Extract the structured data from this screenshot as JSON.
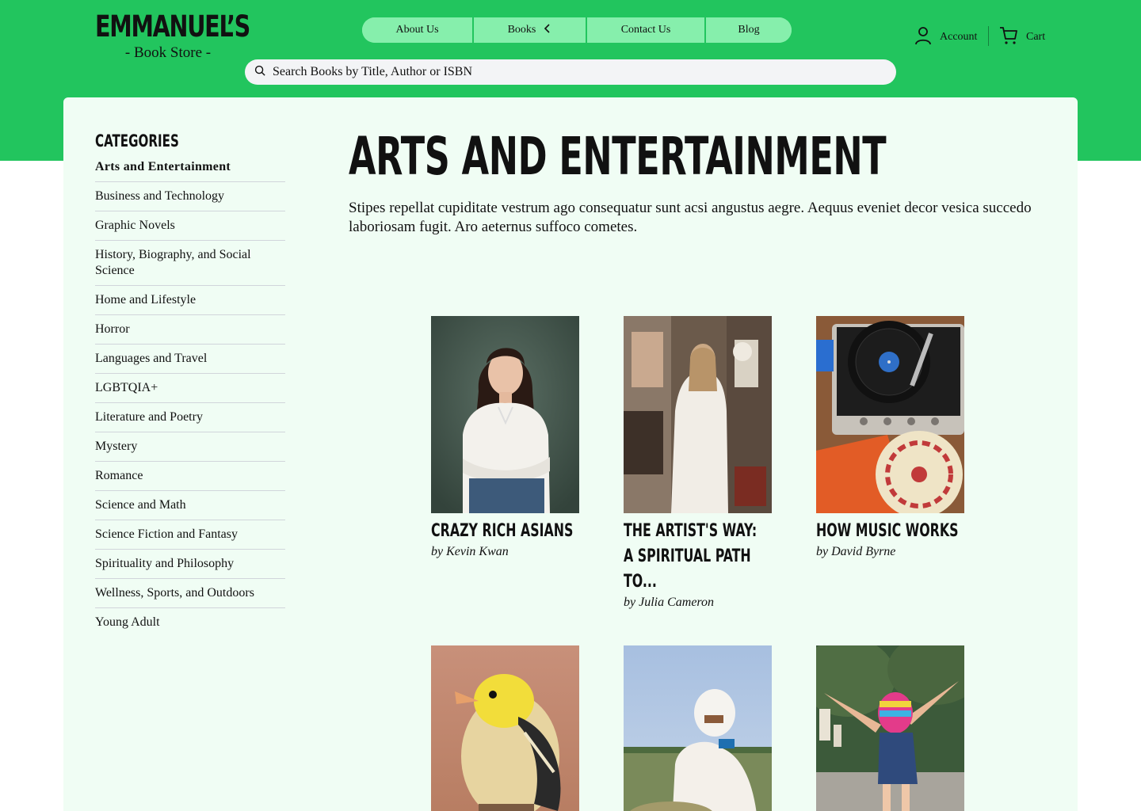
{
  "brand": {
    "name": "EMMANUEL’S",
    "tagline": "- Book Store -"
  },
  "nav": {
    "items": [
      {
        "label": "About Us"
      },
      {
        "label": "Books"
      },
      {
        "label": "Contact Us"
      },
      {
        "label": "Blog"
      }
    ]
  },
  "search": {
    "placeholder": "Search Books by Title, Author or ISBN"
  },
  "header_actions": {
    "account": "Account",
    "cart": "Cart"
  },
  "sidebar": {
    "heading": "CATEGORIES",
    "categories": [
      "Arts and Entertainment",
      "Business and Technology",
      "Graphic Novels",
      "History, Biography, and Social Science",
      "Home and Lifestyle",
      "Horror",
      "Languages and Travel",
      "LGBTQIA+",
      "Literature and Poetry",
      "Mystery",
      "Romance",
      "Science and Math",
      "Science Fiction and Fantasy",
      "Spirituality and Philosophy",
      "Wellness, Sports, and Outdoors",
      "Young Adult"
    ]
  },
  "main": {
    "title": "ARTS AND ENTERTAINMENT",
    "description": "Stipes repellat cupiditate vestrum ago consequatur sunt acsi angustus aegre. Aequus eveniet decor vesica succedo laboriosam fugit. Aro aeternus suffoco cometes.",
    "books": [
      {
        "title": "CRAZY RICH ASIANS",
        "author": "by Kevin Kwan",
        "cover": "woman-portrait-cover"
      },
      {
        "title": "THE ARTIST'S WAY: A SPIRITUAL PATH TO...",
        "author": "by Julia Cameron",
        "cover": "artist-studio-cover"
      },
      {
        "title": "HOW MUSIC WORKS",
        "author": "by David Byrne",
        "cover": "record-player-cover"
      },
      {
        "title": "",
        "author": "",
        "cover": "yellow-bird-cover"
      },
      {
        "title": "",
        "author": "",
        "cover": "farmer-cover"
      },
      {
        "title": "",
        "author": "",
        "cover": "jumping-child-cover"
      }
    ]
  },
  "colors": {
    "brand_green": "#22c55e",
    "nav_pill": "#86efac",
    "panel_bg": "#f0fdf4"
  }
}
